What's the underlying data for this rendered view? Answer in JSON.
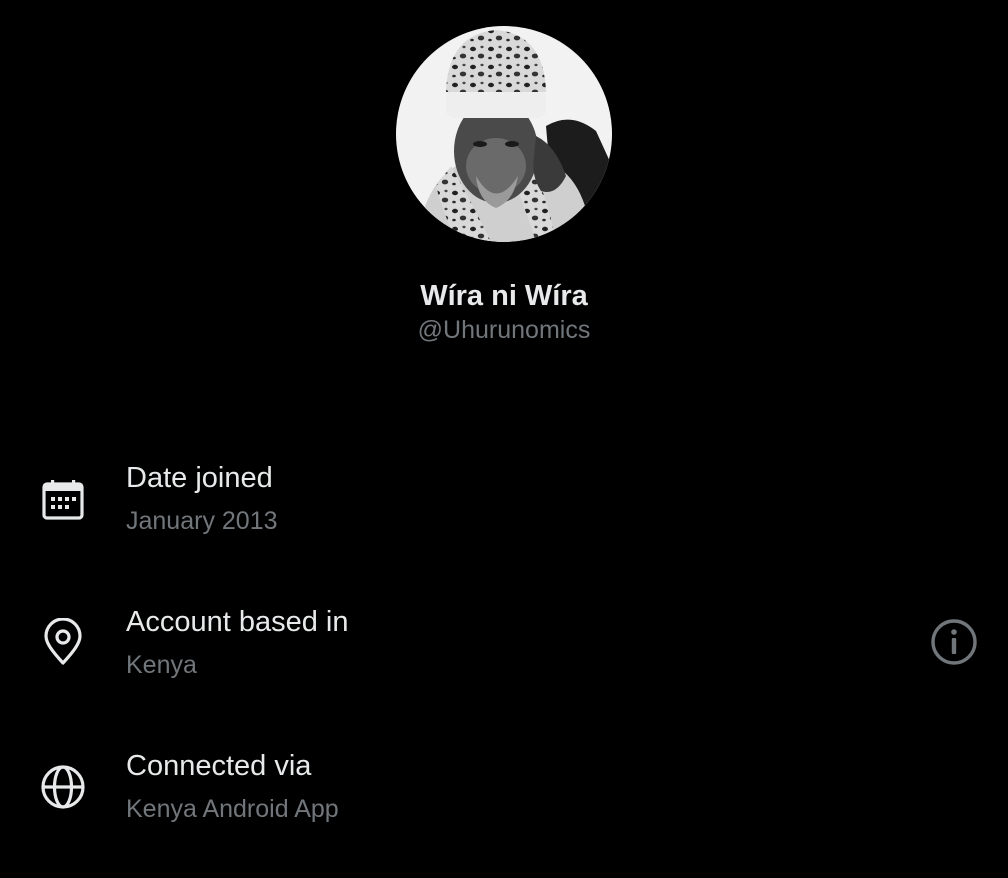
{
  "profile": {
    "display_name": "Wíra ni Wíra",
    "handle": "@Uhurunomics",
    "avatar_icon": "profile-photo"
  },
  "info": {
    "date_joined": {
      "label": "Date joined",
      "value": "January 2013",
      "icon": "calendar-icon"
    },
    "account_based_in": {
      "label": "Account based in",
      "value": "Kenya",
      "icon": "location-pin-icon",
      "info_icon": "info-icon"
    },
    "connected_via": {
      "label": "Connected via",
      "value": "Kenya Android App",
      "icon": "globe-icon"
    }
  },
  "colors": {
    "background": "#000000",
    "primary_text": "#e7e9ea",
    "secondary_text": "#71767b"
  }
}
